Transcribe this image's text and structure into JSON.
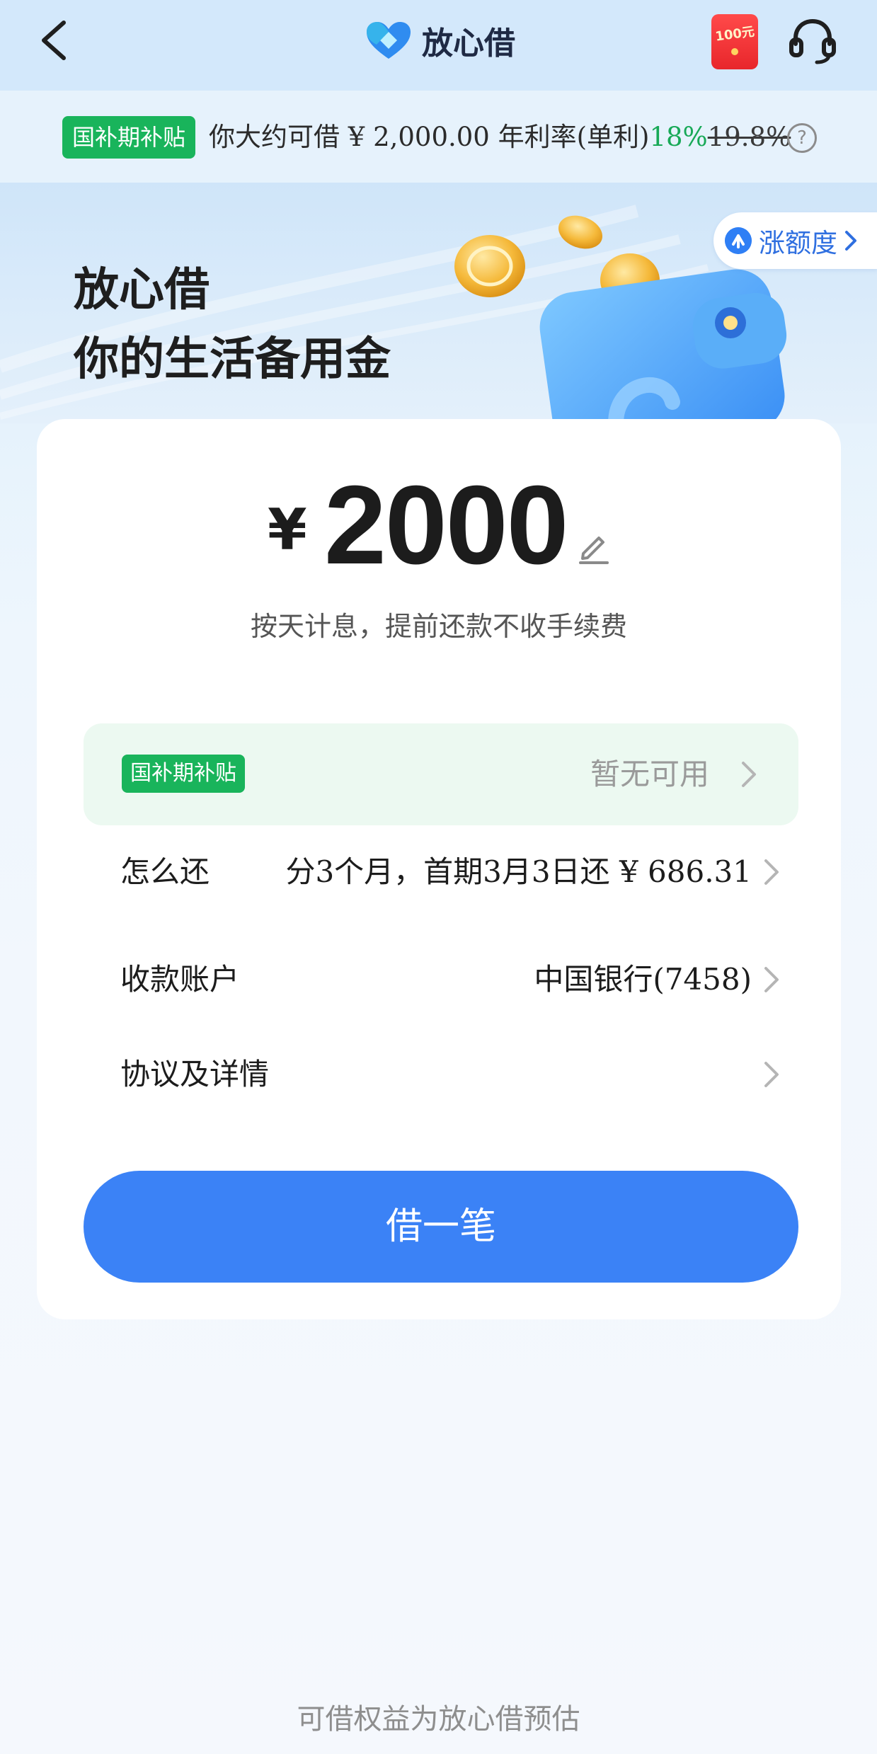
{
  "header": {
    "brand_title": "放心借",
    "redpacket_label": "100元",
    "back_icon": "chevron-left-icon",
    "service_icon": "headset-icon"
  },
  "info_bar": {
    "tag": "国补期补贴",
    "text_prefix": "你大约可借 ¥ 2,000.00  年利率(单利)",
    "rate_new": "18%",
    "rate_old": "19.8%",
    "help_label": "?"
  },
  "hero": {
    "title": "放心借",
    "subtitle": "你的生活备用金",
    "raise_limit_label": "涨额度"
  },
  "loan": {
    "currency": "¥",
    "amount": "2000",
    "note": "按天计息，提前还款不收手续费"
  },
  "subsidy": {
    "tag": "国补期补贴",
    "status": "暂无可用"
  },
  "rows": [
    {
      "label": "怎么还",
      "value": "分3个月，首期3月3日还 ¥ 686.31"
    },
    {
      "label": "收款账户",
      "value": "中国银行(7458)"
    },
    {
      "label": "协议及详情",
      "value": ""
    }
  ],
  "borrow_button": "借一笔",
  "footer_note": "可借权益为放心借预估",
  "colors": {
    "primary_blue": "#3b82f6",
    "subsidy_green": "#19b45b",
    "rate_green": "#18a957"
  }
}
